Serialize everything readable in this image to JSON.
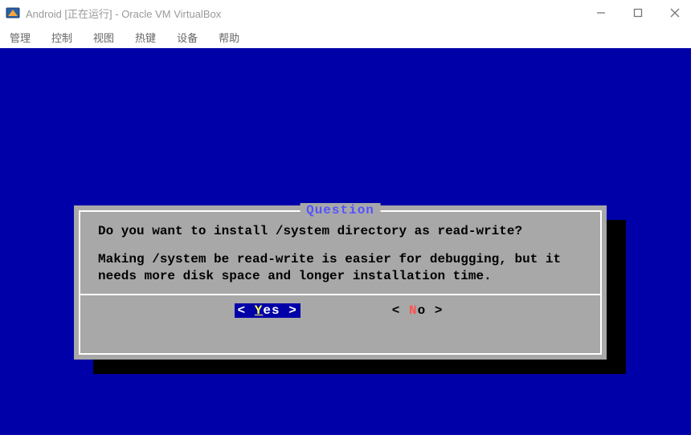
{
  "window": {
    "title": "Android [正在运行] - Oracle VM VirtualBox"
  },
  "menubar": {
    "items": [
      "管理",
      "控制",
      "视图",
      "热键",
      "设备",
      "帮助"
    ]
  },
  "dialog": {
    "title": "Question",
    "line1": "Do you want to install /system directory as read-write?",
    "line2": "Making /system be read-write is easier for debugging, but it needs more disk space and longer installation time.",
    "buttons": {
      "yes": {
        "bracket_open": "<",
        "hotkey": "Y",
        "rest": "es",
        "bracket_close": ">",
        "selected": true
      },
      "no": {
        "bracket_open": "<",
        "hotkey": "N",
        "rest": "o",
        "bracket_close": ">",
        "selected": false
      }
    }
  }
}
